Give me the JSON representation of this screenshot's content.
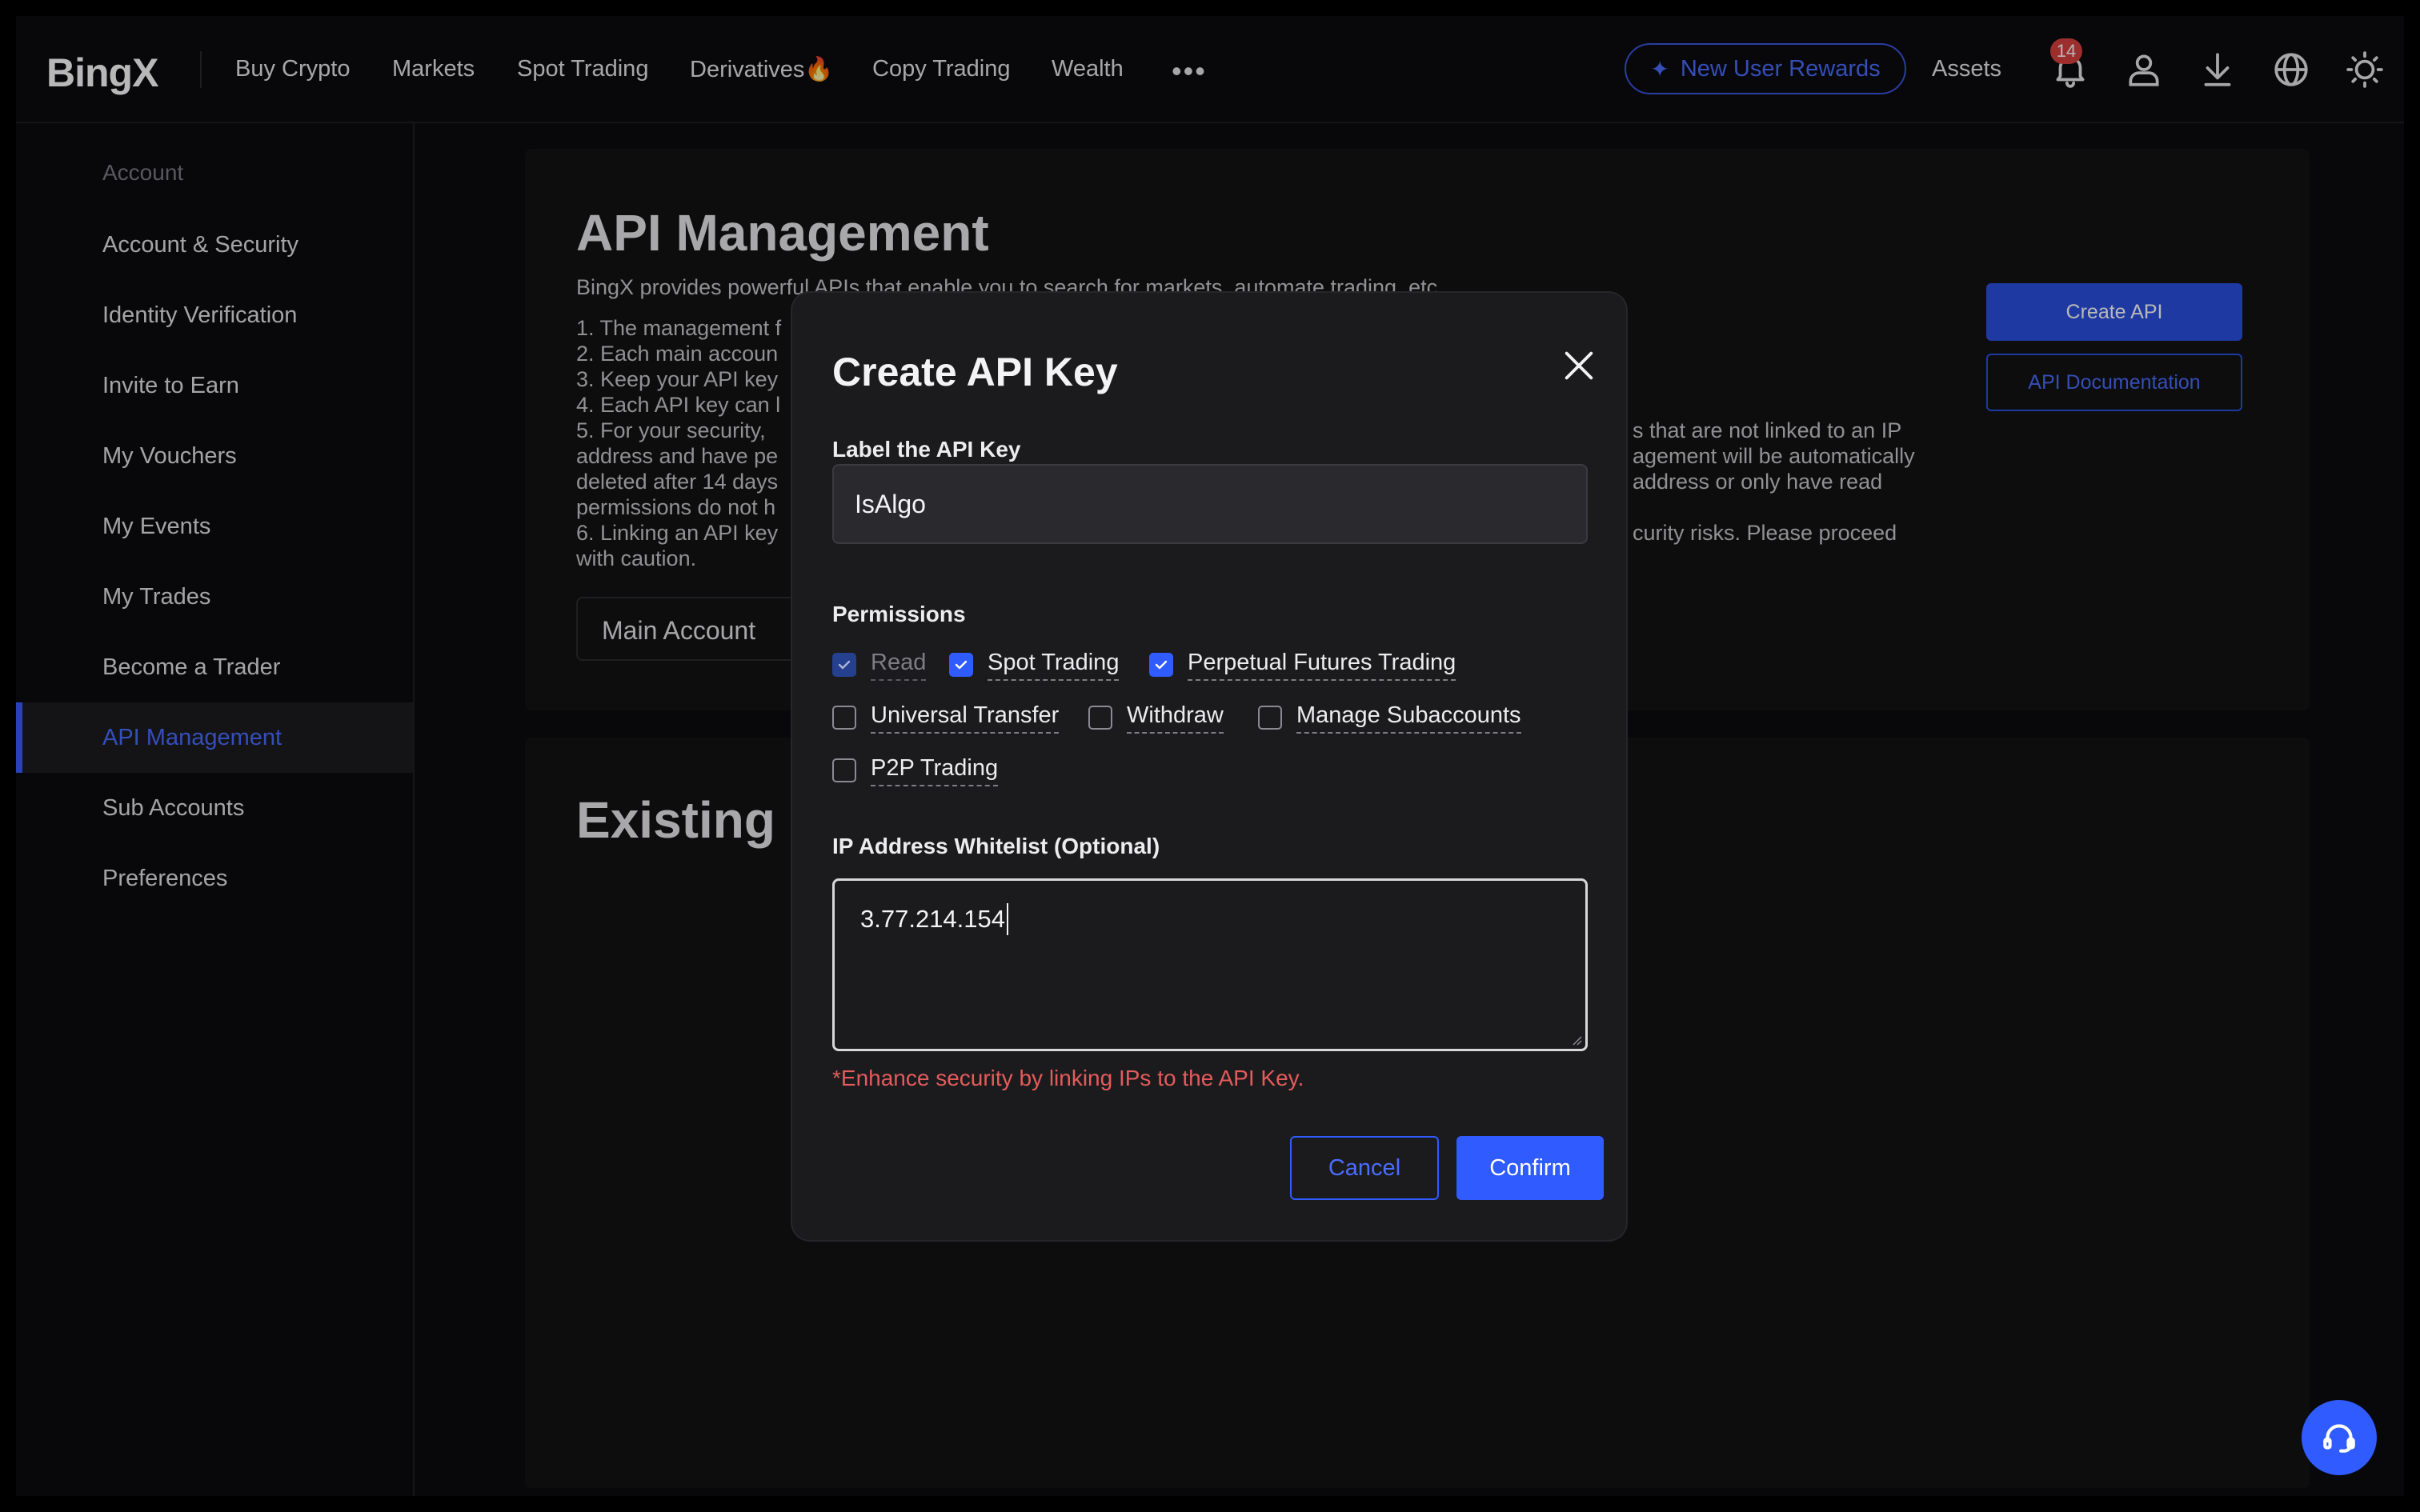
{
  "brand": "BingX",
  "nav": {
    "items": [
      {
        "label": "Buy Crypto"
      },
      {
        "label": "Markets"
      },
      {
        "label": "Spot Trading"
      },
      {
        "label": "Derivatives🔥"
      },
      {
        "label": "Copy Trading"
      },
      {
        "label": "Wealth"
      }
    ],
    "more": "•••",
    "rewards_label": "New User Rewards",
    "assets_label": "Assets",
    "notification_count": "14"
  },
  "sidebar": {
    "heading": "Account",
    "items": [
      {
        "label": "Account & Security"
      },
      {
        "label": "Identity Verification"
      },
      {
        "label": "Invite to Earn"
      },
      {
        "label": "My Vouchers"
      },
      {
        "label": "My Events"
      },
      {
        "label": "My Trades"
      },
      {
        "label": "Become a Trader"
      },
      {
        "label": "API Management",
        "active": true
      },
      {
        "label": "Sub Accounts"
      },
      {
        "label": "Preferences"
      }
    ]
  },
  "page": {
    "title": "API Management",
    "intro": "BingX provides powerful APIs that enable you to search for markets, automate trading, etc.",
    "notes_left": [
      "1. The management f",
      "2. Each main accoun",
      "3. Keep your API key",
      "4. Each API key can l",
      "5. For your security,",
      "address and have pe",
      "deleted after 14 days",
      "permissions do not h",
      "6. Linking an API key",
      "with caution."
    ],
    "notes_right": [
      "s that are not linked to an IP",
      "agement will be automatically",
      "address or only have read",
      "curity risks. Please proceed"
    ],
    "account_selector": "Main Account",
    "create_api_label": "Create API",
    "api_doc_label": "API Documentation",
    "existing_title": "Existing"
  },
  "modal": {
    "title": "Create API Key",
    "label_field_title": "Label the API Key",
    "label_value": "IsAlgo",
    "permissions_title": "Permissions",
    "permissions": [
      {
        "label": "Read",
        "checked": true,
        "disabled": true
      },
      {
        "label": "Spot Trading",
        "checked": true
      },
      {
        "label": "Perpetual Futures Trading",
        "checked": true
      },
      {
        "label": "Universal Transfer",
        "checked": false
      },
      {
        "label": "Withdraw",
        "checked": false
      },
      {
        "label": "Manage Subaccounts",
        "checked": false
      },
      {
        "label": "P2P Trading",
        "checked": false
      }
    ],
    "ip_title": "IP Address Whitelist (Optional)",
    "ip_value": "3.77.214.154",
    "warning": "*Enhance security by linking IPs to the API Key.",
    "cancel_label": "Cancel",
    "confirm_label": "Confirm"
  },
  "colors": {
    "accent": "#2f5bff",
    "warning": "#e45b5b",
    "badge": "#d9423f"
  }
}
